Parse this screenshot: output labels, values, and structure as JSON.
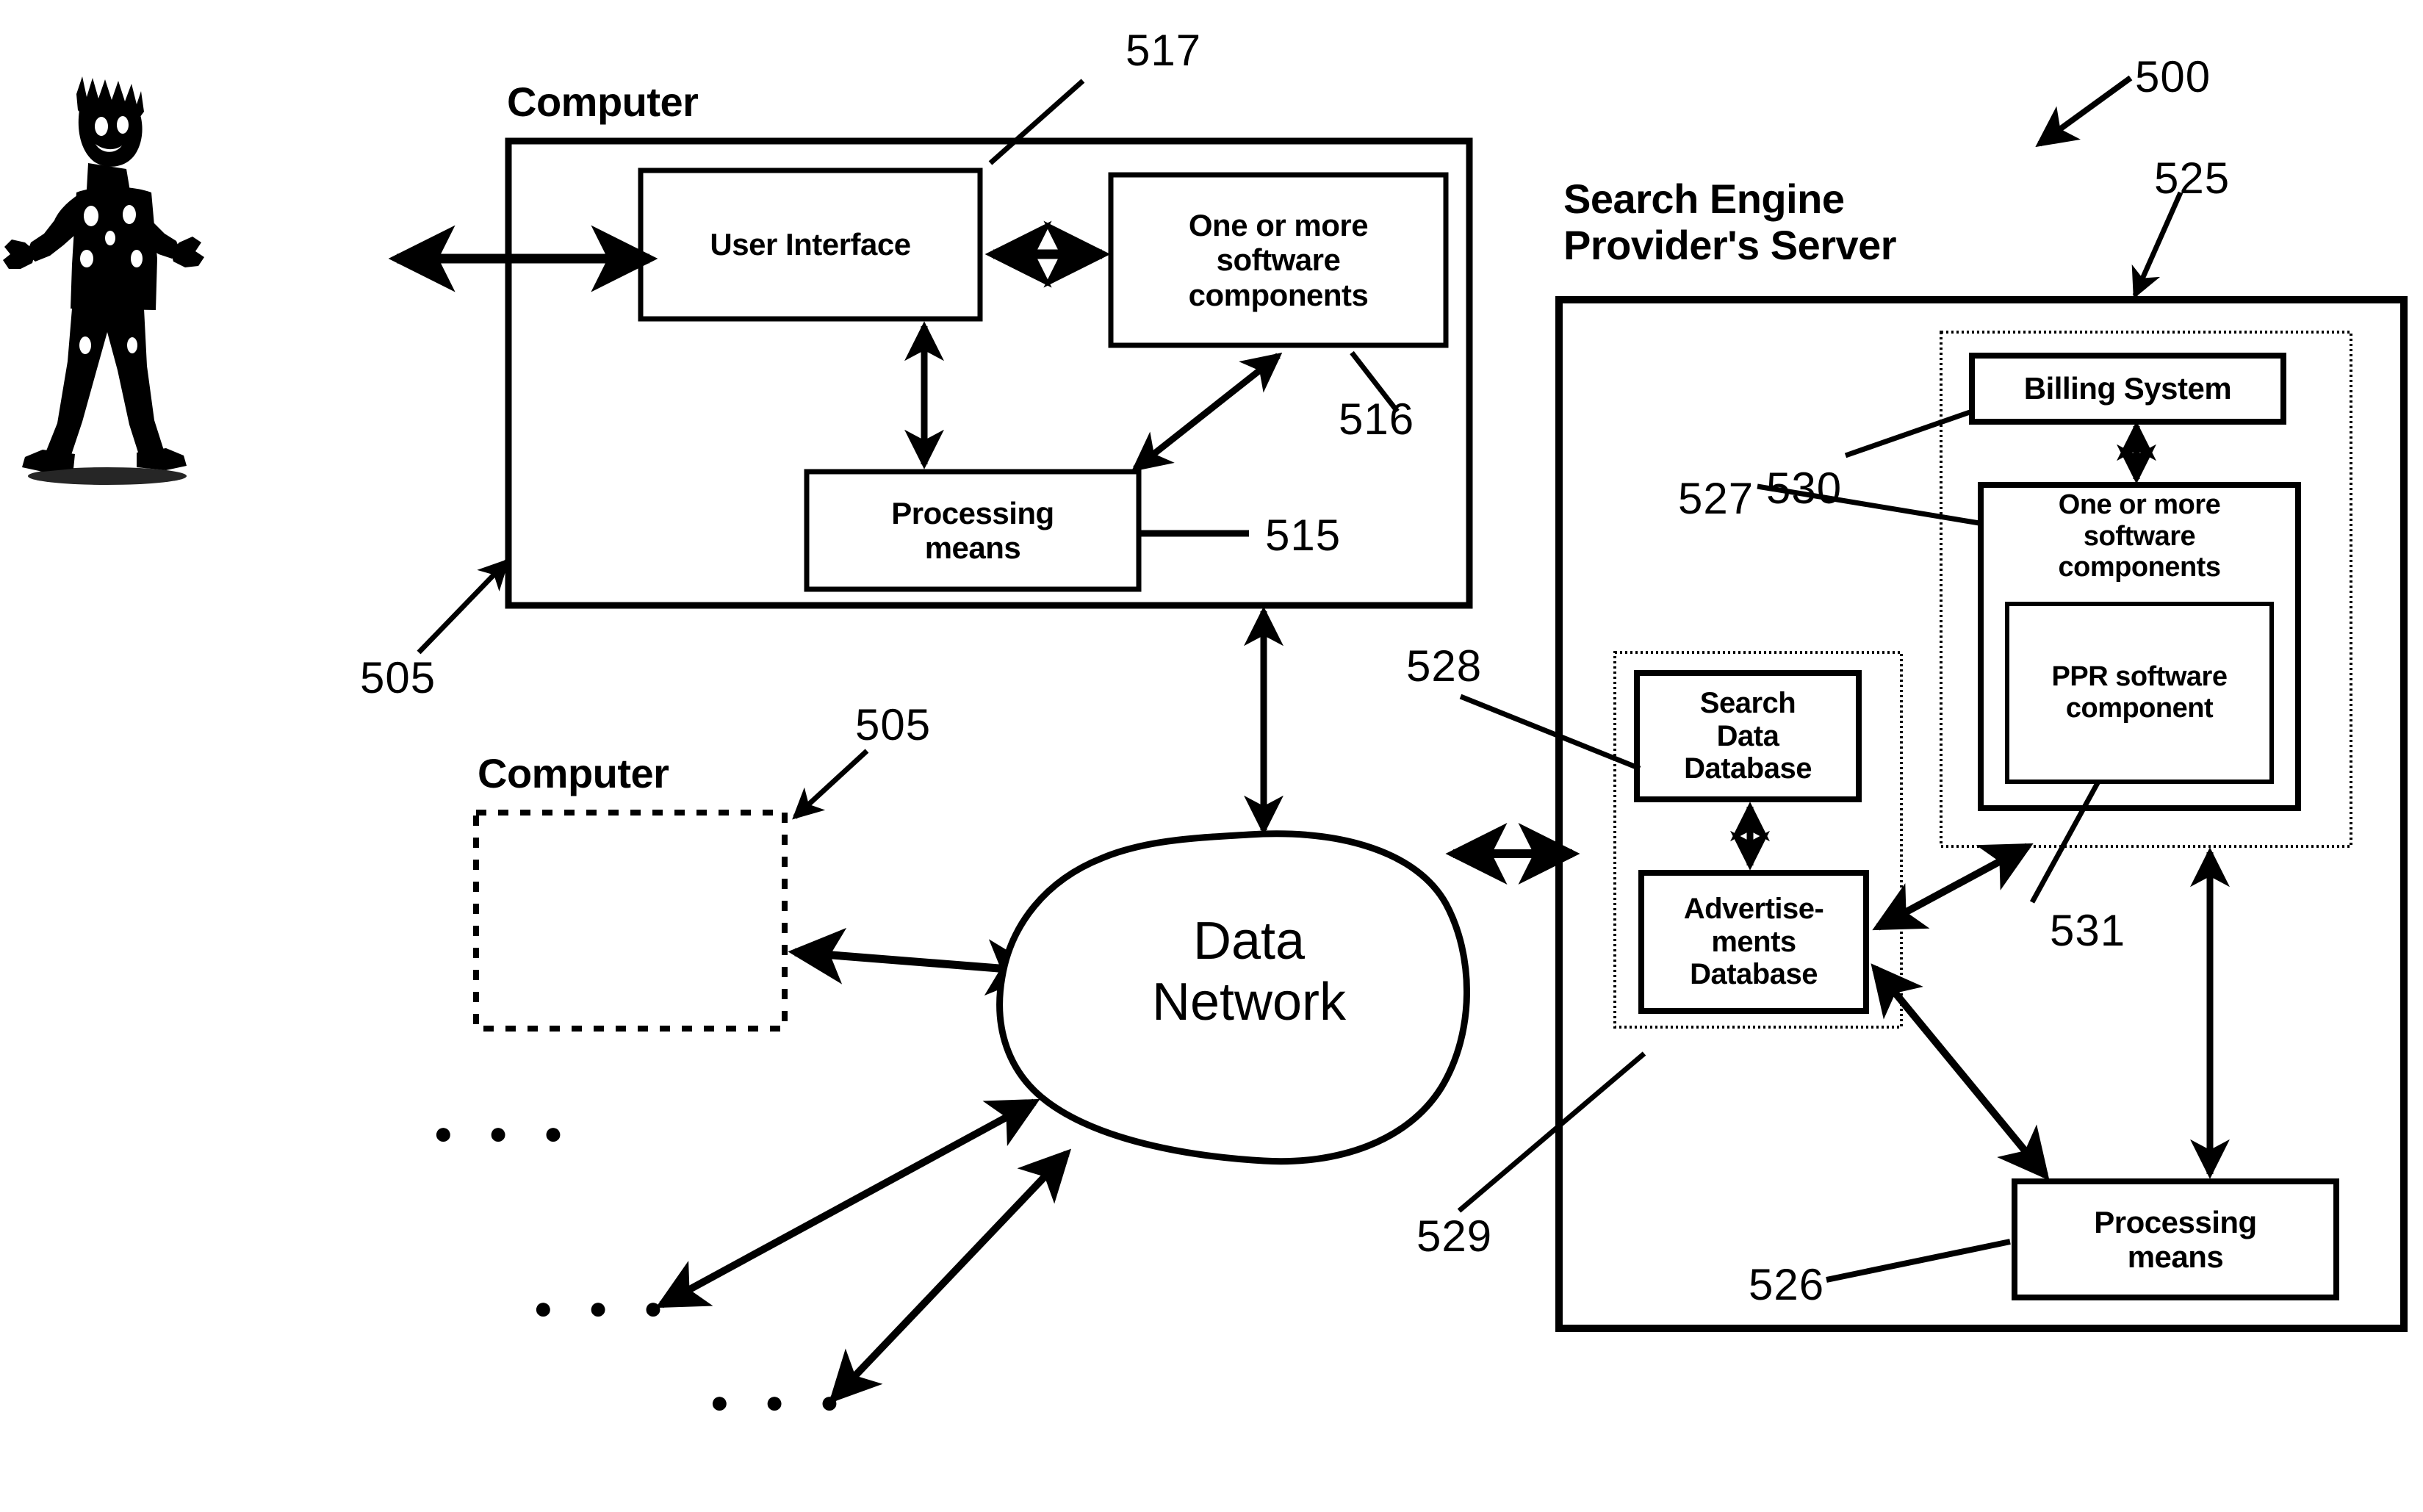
{
  "figure": {
    "type": "patent-system-block-diagram",
    "background_color": "#ffffff",
    "line_color": "#000000"
  },
  "reference_numerals": {
    "system": "500",
    "computer": "505",
    "computer_second": "505",
    "processing_means_client": "515",
    "software_components_client": "516",
    "user_interface": "517",
    "server": "525",
    "processing_means_server": "526",
    "software_components_server": "527",
    "search_data_database": "528",
    "advertisements_database": "529",
    "billing_system": "530",
    "ppr_software_component": "531"
  },
  "client": {
    "heading": "Computer",
    "user_interface_label": "User Interface",
    "software_components_label": "One or more\nsoftware\ncomponents",
    "processing_means_label": "Processing\nmeans"
  },
  "client_second": {
    "heading": "Computer"
  },
  "network": {
    "label": "Data\nNetwork"
  },
  "server": {
    "heading": "Search Engine\nProvider's Server",
    "billing_system_label": "Billing System",
    "software_components_label": "One or more\nsoftware\ncomponents",
    "ppr_component_label": "PPR software\ncomponent",
    "search_data_database_label": "Search\nData\nDatabase",
    "advertisements_database_label": "Advertise-\nments\nDatabase",
    "processing_means_label": "Processing\nmeans"
  },
  "ellipsis": {
    "group_1": "● ● ●",
    "group_2": "● ● ●",
    "group_3": "● ● ●"
  },
  "actor": {
    "label": "user-figure"
  }
}
